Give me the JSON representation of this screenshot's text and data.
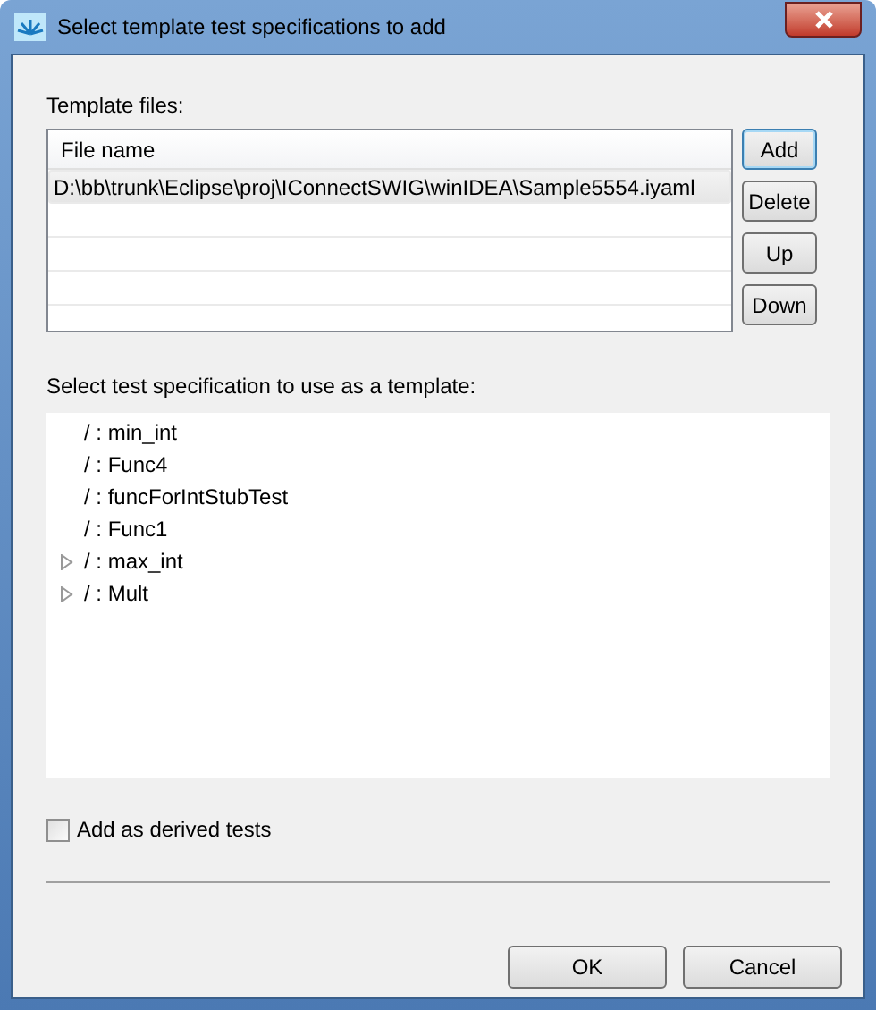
{
  "window": {
    "title": "Select template test specifications to add"
  },
  "template_files": {
    "label": "Template files:",
    "column": "File name",
    "rows": [
      {
        "file_name": "D:\\bb\\trunk\\Eclipse\\proj\\IConnectSWIG\\winIDEA\\Sample5554.iyaml",
        "selected": true
      }
    ],
    "buttons": [
      {
        "label": "Add",
        "focused": true
      },
      {
        "label": "Delete",
        "focused": false
      },
      {
        "label": "Up",
        "focused": false
      },
      {
        "label": "Down",
        "focused": false
      }
    ]
  },
  "tree": {
    "label": "Select test specification to use as a template:",
    "items": [
      {
        "kind": "leaf",
        "label": "/ : min_int"
      },
      {
        "kind": "leaf",
        "label": "/ : Func4"
      },
      {
        "kind": "leaf",
        "label": "/ : funcForIntStubTest"
      },
      {
        "kind": "leaf",
        "label": "/ : Func1"
      },
      {
        "kind": "branch",
        "label": "/ : max_int",
        "expanded": false
      },
      {
        "kind": "branch",
        "label": "/ : Mult",
        "expanded": false
      }
    ]
  },
  "derived": {
    "label": "Add as derived tests",
    "checked": false
  },
  "buttons": [
    "OK",
    "Cancel"
  ]
}
